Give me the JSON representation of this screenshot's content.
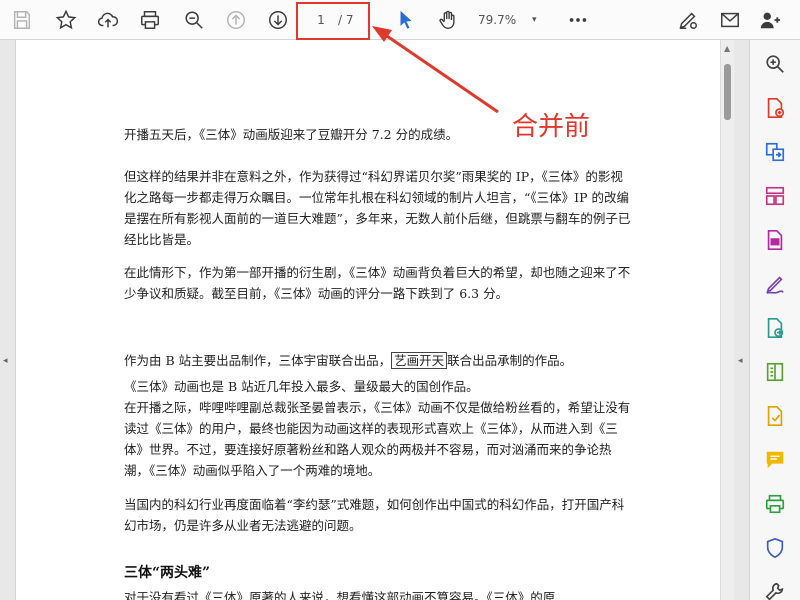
{
  "toolbar": {
    "page_current": "1",
    "page_total": "/ 7",
    "zoom": "79.7%",
    "zoom_caret": "▾",
    "icons": [
      "save-icon",
      "star-icon",
      "cloud-upload-icon",
      "print-icon",
      "zoom-out-icon",
      "prev-page-icon",
      "next-page-icon",
      "select-cursor-icon",
      "hand-icon",
      "more-icon",
      "sign-icon",
      "email-icon",
      "add-user-icon"
    ]
  },
  "annotation": {
    "text": "合并前",
    "color": "#e0392b"
  },
  "document": {
    "p1": "开播五天后，《三体》动画版迎来了豆瓣开分 7.2 分的成绩。",
    "p2": "但这样的结果并非在意料之外，作为获得过“科幻界诺贝尔奖”雨果奖的 IP，《三体》的影视化之路每一步都走得万众瞩目。一位常年扎根在科幻领域的制片人坦言，“《三体》IP 的改编是摆在所有影视人面前的一道巨大难题”，多年来，无数人前仆后继，但跳票与翻车的例子已经比比皆是。",
    "p3": "在此情形下，作为第一部开播的衍生剧，《三体》动画背负着巨大的希望，却也随之迎来了不少争议和质疑。截至目前，《三体》动画的评分一路下跌到了 6.3 分。",
    "p4_before": "作为由 B 站主要出品制作，三体宇宙联合出品，",
    "p4_boxed": "艺画开天",
    "p4_after": "联合出品承制的作品。",
    "p5": "《三体》动画也是 B 站近几年投入最多、量级最大的国创作品。",
    "p6": "在开播之际，哔哩哔哩副总裁张圣晏曾表示，《三体》动画不仅是做给粉丝看的，希望让没有读过《三体》的用户，最终也能因为动画这样的表现形式喜欢上《三体》，从而进入到《三体》世界。不过，要连接好原著粉丝和路人观众的两极并不容易，而对汹涌而来的争论热潮，《三体》动画似乎陷入了一个两难的境地。",
    "p7": "当国内的科幻行业再度面临着“李约瑟”式难题，如何创作出中国式的科幻作品，打开国产科幻市场，仍是许多从业者无法逃避的问题。",
    "h1": "三体“两头难”",
    "p8": "对于没有看过《三体》原著的人来说，想看懂这部动画不算容易。《三体》的原"
  },
  "nav": {
    "left_arrow": "◂",
    "right_arrow": "◂",
    "scroll_up": "▲"
  },
  "colors": {
    "accent": "#e0392b",
    "blue": "#2a6dd8"
  }
}
